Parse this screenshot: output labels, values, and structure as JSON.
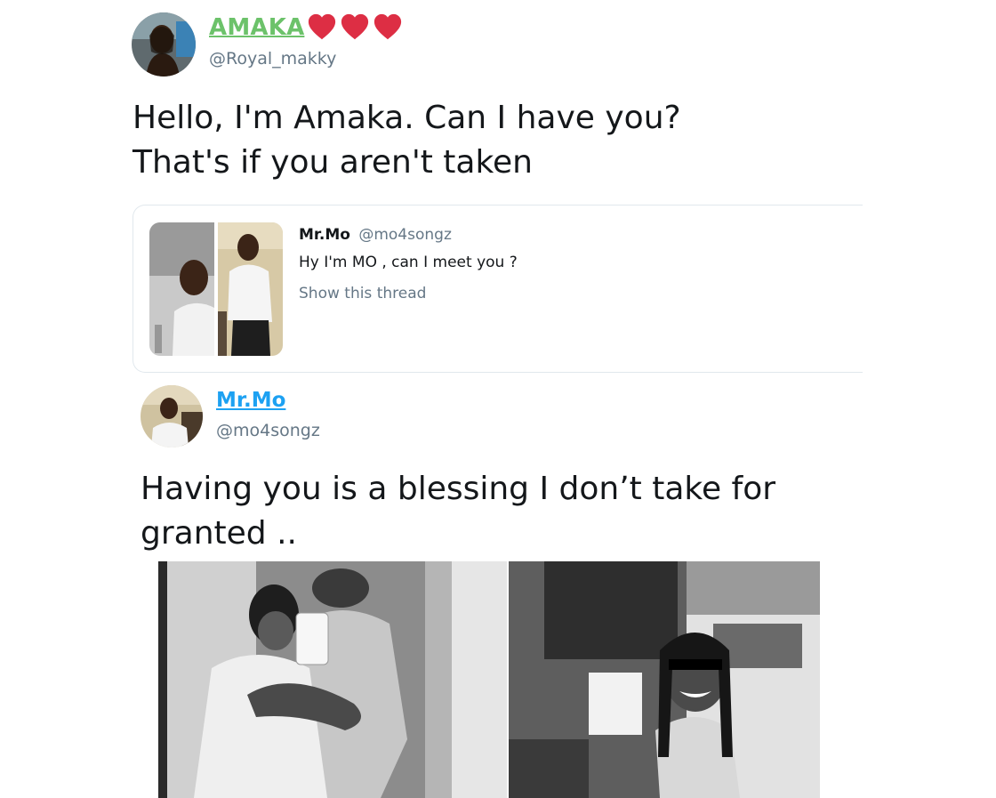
{
  "tweet1": {
    "display_name": "AMAKA",
    "handle": "@Royal_makky",
    "text_line1": "Hello, I'm Amaka. Can I have you?",
    "text_line2": "That's if you aren't taken",
    "name_color": "#6cc26a",
    "heart_color": "#dd2e44"
  },
  "quoted": {
    "display_name": "Mr.Mo",
    "handle": "@mo4songz",
    "text": "Hy I'm MO , can I meet you ?",
    "show_thread": "Show this thread"
  },
  "tweet2": {
    "display_name": "Mr.Mo",
    "handle": "@mo4songz",
    "text_line1": "Having you is a blessing I don’t take for",
    "text_line2": "granted ..",
    "name_color": "#1da1f2"
  },
  "icons": [
    "heart-icon",
    "heart-icon",
    "heart-icon"
  ]
}
